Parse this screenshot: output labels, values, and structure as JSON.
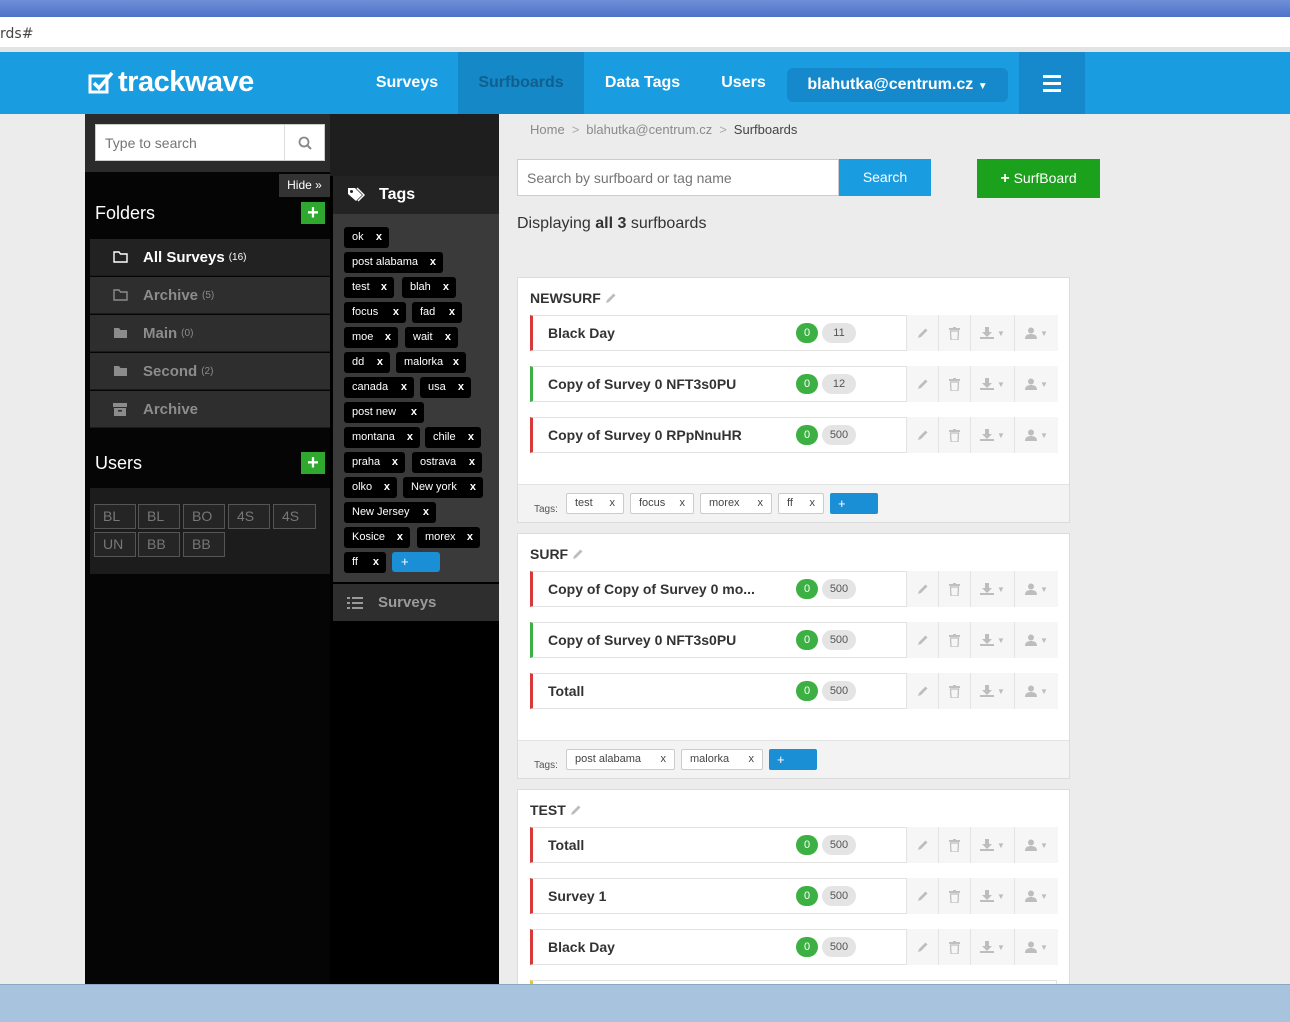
{
  "browser": {
    "address_text": "rds#"
  },
  "nav": {
    "logo": "trackwave",
    "items": [
      "Surveys",
      "Surfboards",
      "Data Tags",
      "Users"
    ],
    "active": "Surfboards",
    "user": "blahutka@centrum.cz",
    "brand_color": "#1a9de0"
  },
  "left": {
    "search_placeholder": "Type to search",
    "hide_label": "Hide",
    "folders_title": "Folders",
    "folders": [
      {
        "label": "All Surveys",
        "count": "(16)",
        "icon": "folder-open-icon",
        "active": true
      },
      {
        "label": "Archive",
        "count": "(5)",
        "icon": "folder-open-icon"
      },
      {
        "label": "Main",
        "count": "(0)",
        "icon": "folder-icon"
      },
      {
        "label": "Second",
        "count": "(2)",
        "icon": "folder-icon"
      },
      {
        "label": "Archive",
        "count": "",
        "icon": "archive-box-icon"
      }
    ],
    "users_title": "Users",
    "user_badges": [
      "BL",
      "BL",
      "BO",
      "4S",
      "4S",
      "UN",
      "BB",
      "BB"
    ]
  },
  "tags_panel": {
    "title": "Tags",
    "tags": [
      "ok",
      "post alabama",
      "test",
      "blah",
      "focus",
      "fad",
      "moe",
      "wait",
      "dd",
      "malorka",
      "canada",
      "usa",
      "post new",
      "montana",
      "chile",
      "praha",
      "ostrava",
      "olko",
      "New york",
      "New Jersey",
      "Kosice",
      "morex",
      "ff"
    ],
    "remove_label": "x",
    "add_label": "+",
    "surveys_label": "Surveys"
  },
  "main": {
    "breadcrumb": [
      "Home",
      "blahutka@centrum.cz",
      "Surfboards"
    ],
    "search_placeholder": "Search by surfboard or tag name",
    "search_button": "Search",
    "add_button": "SurfBoard",
    "display_prefix": "Displaying",
    "display_bold": "all 3",
    "display_suffix": "surfboards",
    "tags_label": "Tags:",
    "add_tag_label": "+",
    "surfboards": [
      {
        "name": "NEWSURF",
        "surveys": [
          {
            "name": "Black Day",
            "zero": "0",
            "count": "11",
            "status": "red"
          },
          {
            "name": "Copy of Survey 0 NFT3s0PU",
            "zero": "0",
            "count": "12",
            "status": "green"
          },
          {
            "name": "Copy of Survey 0 RPpNnuHR",
            "zero": "0",
            "count": "500",
            "status": "red"
          }
        ],
        "tags": [
          "test",
          "focus",
          "morex",
          "ff"
        ]
      },
      {
        "name": "SURF",
        "surveys": [
          {
            "name": "Copy of Copy of Survey 0 mo...",
            "zero": "0",
            "count": "500",
            "status": "red"
          },
          {
            "name": "Copy of Survey 0 NFT3s0PU",
            "zero": "0",
            "count": "500",
            "status": "green"
          },
          {
            "name": "Totall",
            "zero": "0",
            "count": "500",
            "status": "red"
          }
        ],
        "tags": [
          "post alabama",
          "malorka"
        ]
      },
      {
        "name": "TEST",
        "surveys": [
          {
            "name": "Totall",
            "zero": "0",
            "count": "500",
            "status": "red"
          },
          {
            "name": "Survey 1",
            "zero": "0",
            "count": "500",
            "status": "red"
          },
          {
            "name": "Black Day",
            "zero": "0",
            "count": "500",
            "status": "red"
          }
        ],
        "tags": []
      }
    ]
  }
}
